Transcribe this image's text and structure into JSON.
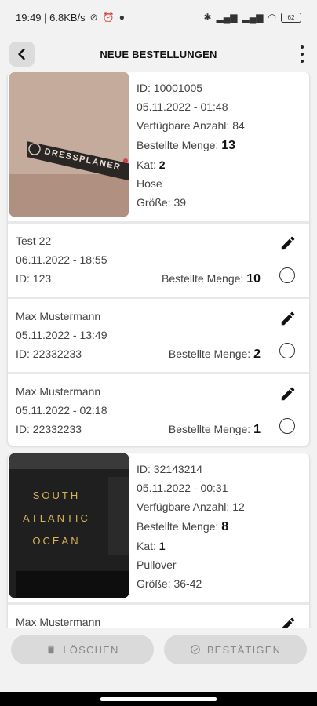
{
  "status_bar": {
    "time_speed": "19:49 | 6.8KB/s",
    "battery": "62"
  },
  "app_bar": {
    "title": "NEUE BESTELLUNGEN"
  },
  "products": [
    {
      "id_line": "ID: 10001005",
      "date": "05.11.2022 - 01:48",
      "available": "Verfügbare Anzahl: 84",
      "ordered_label": "Bestellte Menge:",
      "ordered_value": "13",
      "kat_label": "Kat:",
      "kat_value": "2",
      "type": "Hose",
      "size": "Größe: 39",
      "image_text": "DRESSPLANER",
      "orders": [
        {
          "name": "Test 22",
          "date": "06.11.2022 - 18:55",
          "id": "ID: 123",
          "qty_label": "Bestellte Menge:",
          "qty": "10"
        },
        {
          "name": "Max Mustermann",
          "date": "05.11.2022 - 13:49",
          "id": "ID: 22332233",
          "qty_label": "Bestellte Menge:",
          "qty": "2"
        },
        {
          "name": "Max Mustermann",
          "date": "05.11.2022 - 02:18",
          "id": "ID: 22332233",
          "qty_label": "Bestellte Menge:",
          "qty": "1"
        }
      ]
    },
    {
      "id_line": "ID: 32143214",
      "date": "05.11.2022 - 00:31",
      "available": "Verfügbare Anzahl: 12",
      "ordered_label": "Bestellte Menge:",
      "ordered_value": "8",
      "kat_label": "Kat:",
      "kat_value": "1",
      "type": "Pullover",
      "size": "Größe: 36-42",
      "image_text_lines": [
        "SOUTH",
        "ATLANTIC",
        "OCEAN"
      ],
      "orders": [
        {
          "name": "Max Mustermann"
        }
      ]
    }
  ],
  "buttons": {
    "delete": "LÖSCHEN",
    "confirm": "BESTÄTIGEN"
  },
  "icons": {
    "back": "back-arrow-icon",
    "more": "more-vert-icon",
    "edit": "pencil-icon",
    "delete": "trash-icon",
    "confirm": "check-circle-icon"
  }
}
